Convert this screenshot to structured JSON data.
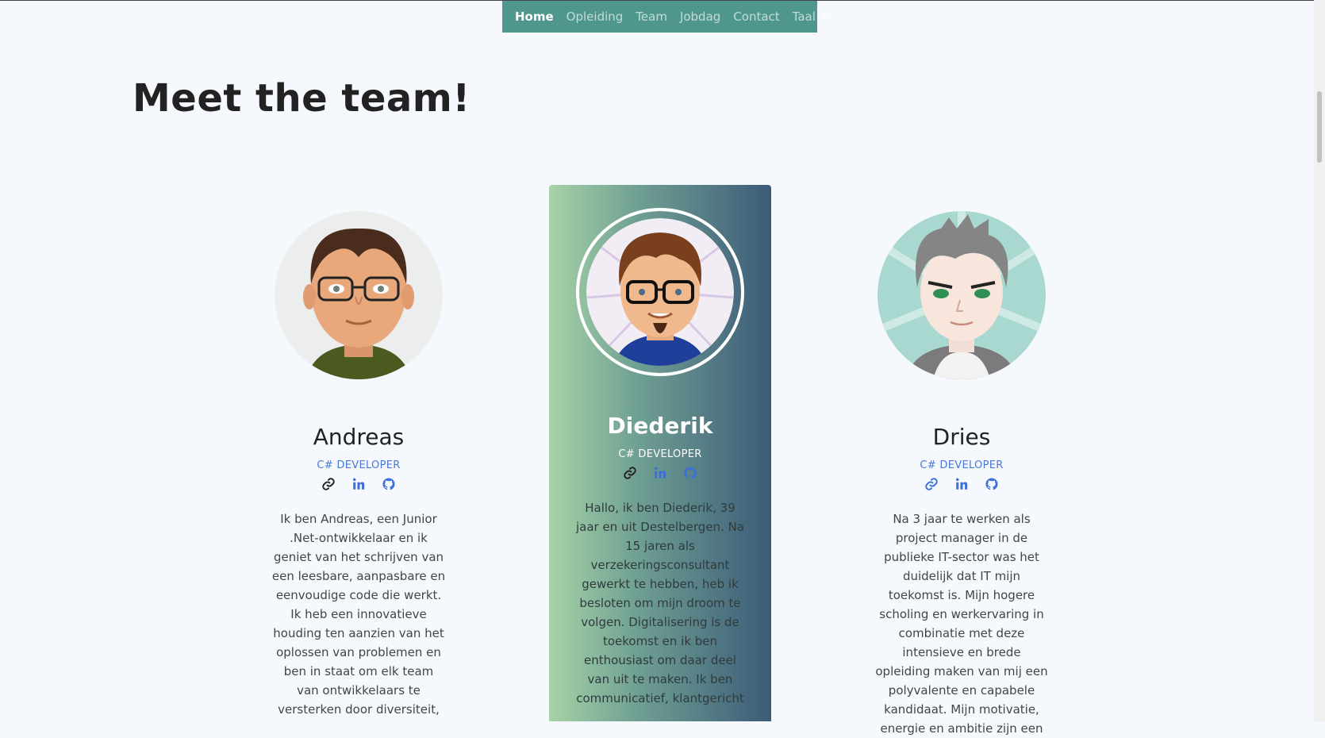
{
  "nav": {
    "items": [
      "Home",
      "Opleiding",
      "Team",
      "Jobdag",
      "Contact"
    ],
    "language_label": "Taal"
  },
  "page": {
    "title": "Meet the team!"
  },
  "team": [
    {
      "name": "Andreas",
      "role": "C# DEVELOPER",
      "bio": "Ik ben Andreas, een Junior .Net-ontwikkelaar en ik geniet van het schrijven van een leesbare, aanpasbare en eenvoudige code die werkt. Ik heb een innovatieve houding ten aanzien van het oplossen van problemen en ben in staat om elk team van ontwikkelaars te versterken door diversiteit,"
    },
    {
      "name": "Diederik",
      "role": "C# DEVELOPER",
      "bio": "Hallo, ik ben Diederik, 39 jaar en uit Destelbergen. Na 15 jaren als verzekeringsconsultant gewerkt te hebben, heb ik besloten om mijn droom te volgen. Digitalisering is de toekomst en ik ben enthousiast om daar deel van uit te maken. Ik ben communicatief, klantgericht"
    },
    {
      "name": "Dries",
      "role": "C# DEVELOPER",
      "bio": "Na 3 jaar te werken als project manager in de publieke IT-sector was het duidelijk dat IT mijn toekomst is. Mijn hogere scholing en werkervaring in combinatie met deze intensieve en brede opleiding maken van mij een polyvalente en capabele kandidaat. Mijn motivatie, energie en ambitie zijn een"
    }
  ],
  "colors": {
    "nav_bg": "#4f978d",
    "accent": "#4a78d6",
    "page_bg": "#f5f9fd"
  },
  "icons": [
    "link-icon",
    "linkedin-icon",
    "github-icon"
  ]
}
